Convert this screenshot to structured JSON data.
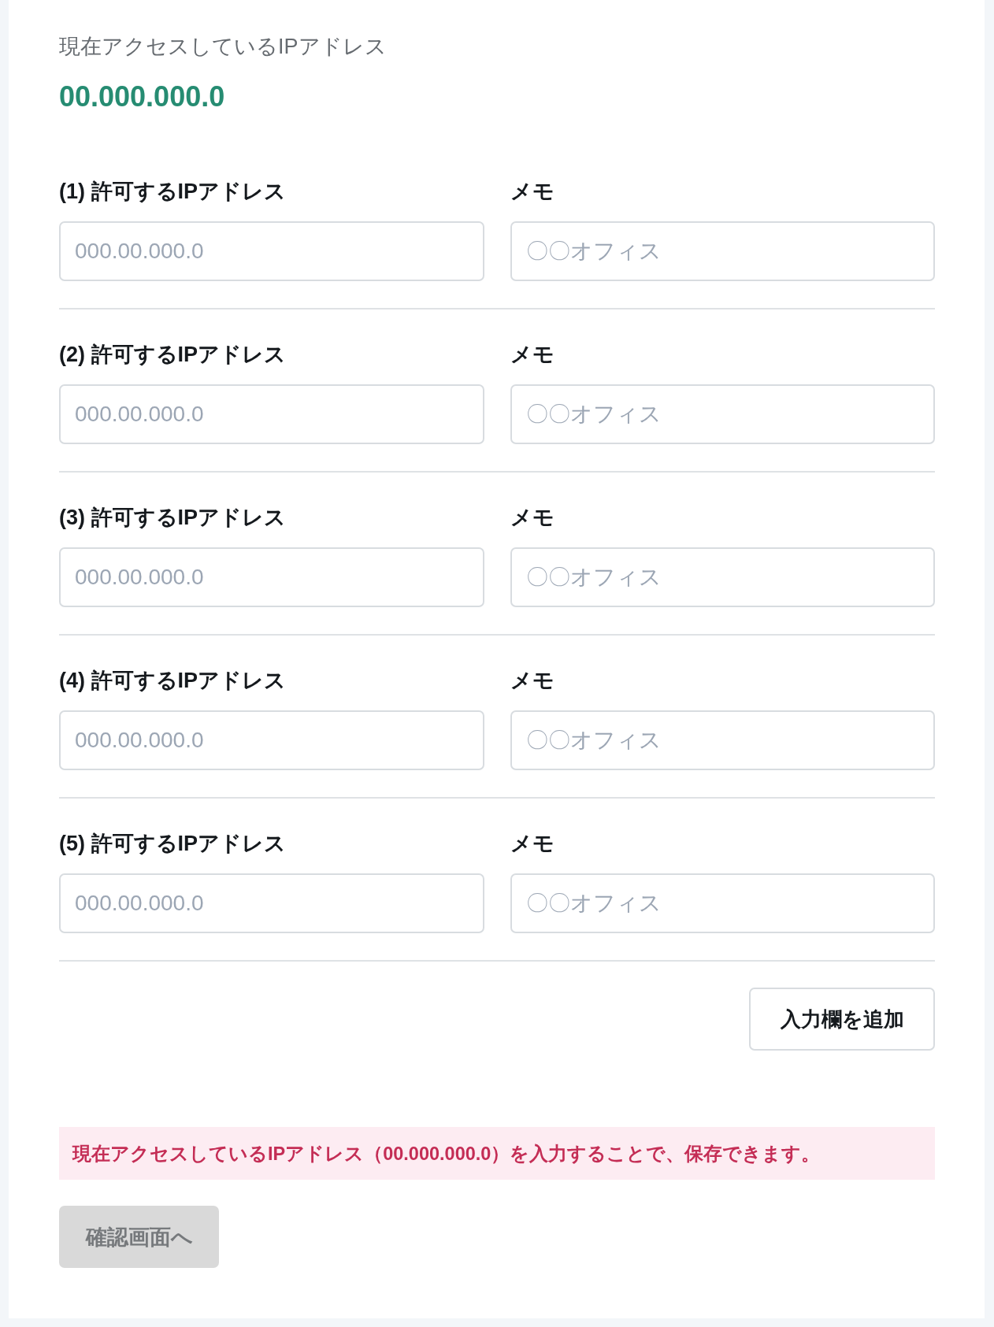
{
  "current_ip": {
    "label": "現在アクセスしているIPアドレス",
    "value": "00.000.000.0"
  },
  "entries": [
    {
      "ip": {
        "label": "(1) 許可するIPアドレス",
        "placeholder": "000.00.000.0"
      },
      "memo": {
        "label": "メモ",
        "placeholder": "〇〇オフィス"
      }
    },
    {
      "ip": {
        "label": "(2) 許可するIPアドレス",
        "placeholder": "000.00.000.0"
      },
      "memo": {
        "label": "メモ",
        "placeholder": "〇〇オフィス"
      }
    },
    {
      "ip": {
        "label": "(3) 許可するIPアドレス",
        "placeholder": "000.00.000.0"
      },
      "memo": {
        "label": "メモ",
        "placeholder": "〇〇オフィス"
      }
    },
    {
      "ip": {
        "label": "(4) 許可するIPアドレス",
        "placeholder": "000.00.000.0"
      },
      "memo": {
        "label": "メモ",
        "placeholder": "〇〇オフィス"
      }
    },
    {
      "ip": {
        "label": "(5) 許可するIPアドレス",
        "placeholder": "000.00.000.0"
      },
      "memo": {
        "label": "メモ",
        "placeholder": "〇〇オフィス"
      }
    }
  ],
  "add_button": {
    "label": "入力欄を追加"
  },
  "error_message": "現在アクセスしているIPアドレス（00.000.000.0）を入力することで、保存できます。",
  "confirm_button": {
    "label": "確認画面へ",
    "disabled": true
  }
}
